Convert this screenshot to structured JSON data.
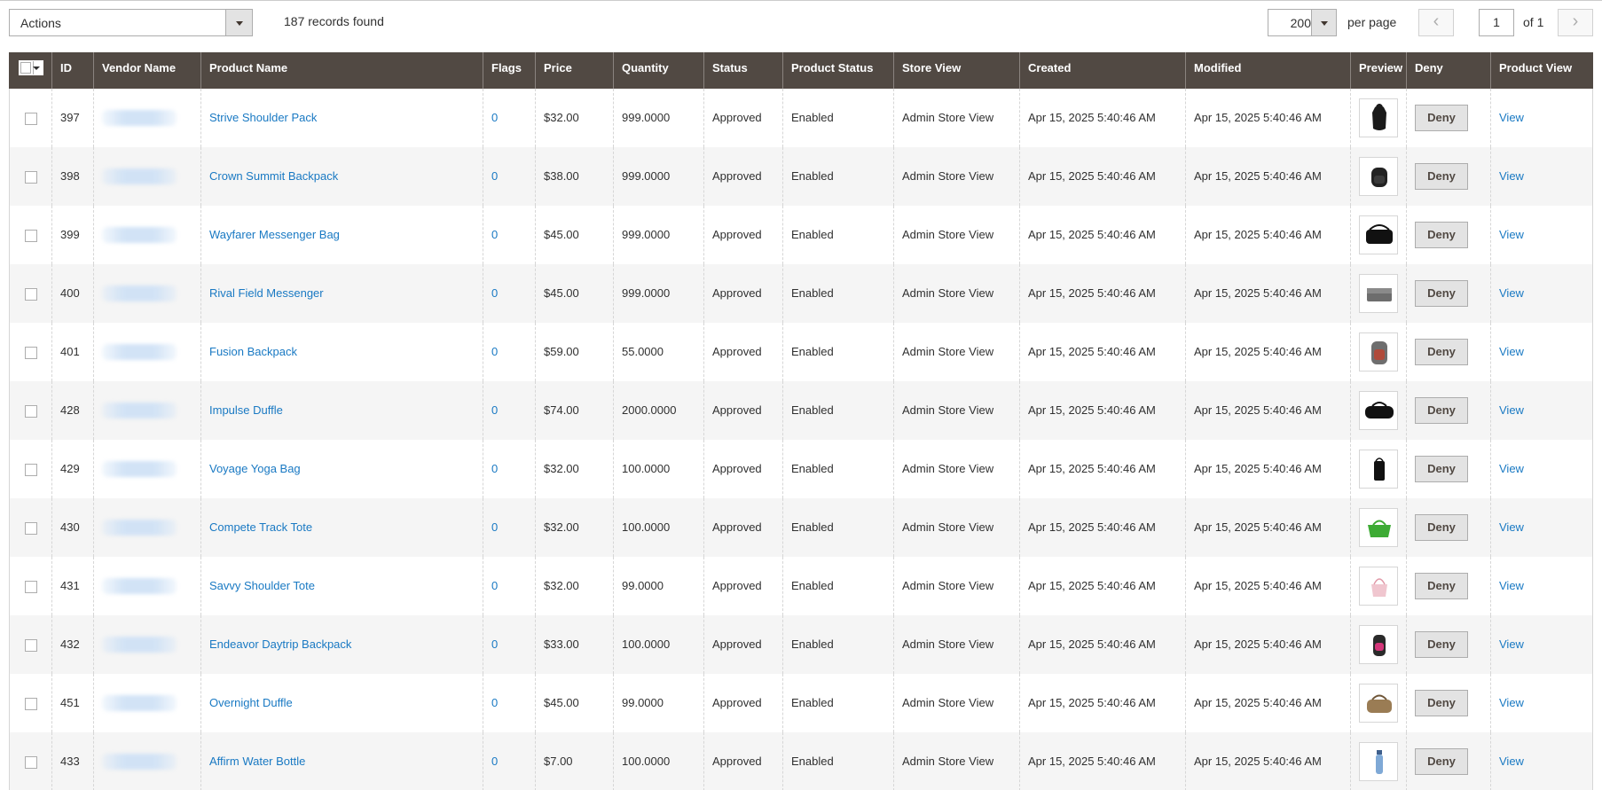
{
  "toolbar": {
    "actions_label": "Actions",
    "records_text": "187 records found",
    "per_page_value": "200",
    "per_page_label": "per page",
    "page_value": "1",
    "page_total": "of 1",
    "prev_glyph": "‹",
    "next_glyph": "›"
  },
  "grid": {
    "columns": [
      "",
      "ID",
      "Vendor Name",
      "Product Name",
      "Flags",
      "Price",
      "Quantity",
      "Status",
      "Product Status",
      "Store View",
      "Created",
      "Modified",
      "Preview",
      "Deny",
      "Product View"
    ],
    "rows": [
      {
        "id": "397",
        "product": "Strive Shoulder Pack",
        "flags": "0",
        "price": "$32.00",
        "qty": "999.0000",
        "status": "Approved",
        "pstatus": "Enabled",
        "store": "Admin Store View",
        "created": "Apr 15, 2025 5:40:46 AM",
        "modified": "Apr 15, 2025 5:40:46 AM",
        "preview": "shoulder-pack-icon",
        "deny": "Deny",
        "view": "View"
      },
      {
        "id": "398",
        "product": "Crown Summit Backpack",
        "flags": "0",
        "price": "$38.00",
        "qty": "999.0000",
        "status": "Approved",
        "pstatus": "Enabled",
        "store": "Admin Store View",
        "created": "Apr 15, 2025 5:40:46 AM",
        "modified": "Apr 15, 2025 5:40:46 AM",
        "preview": "backpack-icon",
        "deny": "Deny",
        "view": "View"
      },
      {
        "id": "399",
        "product": "Wayfarer Messenger Bag",
        "flags": "0",
        "price": "$45.00",
        "qty": "999.0000",
        "status": "Approved",
        "pstatus": "Enabled",
        "store": "Admin Store View",
        "created": "Apr 15, 2025 5:40:46 AM",
        "modified": "Apr 15, 2025 5:40:46 AM",
        "preview": "messenger-bag-icon",
        "deny": "Deny",
        "view": "View"
      },
      {
        "id": "400",
        "product": "Rival Field Messenger",
        "flags": "0",
        "price": "$45.00",
        "qty": "999.0000",
        "status": "Approved",
        "pstatus": "Enabled",
        "store": "Admin Store View",
        "created": "Apr 15, 2025 5:40:46 AM",
        "modified": "Apr 15, 2025 5:40:46 AM",
        "preview": "field-messenger-icon",
        "deny": "Deny",
        "view": "View"
      },
      {
        "id": "401",
        "product": "Fusion Backpack",
        "flags": "0",
        "price": "$59.00",
        "qty": "55.0000",
        "status": "Approved",
        "pstatus": "Enabled",
        "store": "Admin Store View",
        "created": "Apr 15, 2025 5:40:46 AM",
        "modified": "Apr 15, 2025 5:40:46 AM",
        "preview": "fusion-backpack-icon",
        "deny": "Deny",
        "view": "View"
      },
      {
        "id": "428",
        "product": "Impulse Duffle",
        "flags": "0",
        "price": "$74.00",
        "qty": "2000.0000",
        "status": "Approved",
        "pstatus": "Enabled",
        "store": "Admin Store View",
        "created": "Apr 15, 2025 5:40:46 AM",
        "modified": "Apr 15, 2025 5:40:46 AM",
        "preview": "duffle-icon",
        "deny": "Deny",
        "view": "View"
      },
      {
        "id": "429",
        "product": "Voyage Yoga Bag",
        "flags": "0",
        "price": "$32.00",
        "qty": "100.0000",
        "status": "Approved",
        "pstatus": "Enabled",
        "store": "Admin Store View",
        "created": "Apr 15, 2025 5:40:46 AM",
        "modified": "Apr 15, 2025 5:40:46 AM",
        "preview": "yoga-bag-icon",
        "deny": "Deny",
        "view": "View"
      },
      {
        "id": "430",
        "product": "Compete Track Tote",
        "flags": "0",
        "price": "$32.00",
        "qty": "100.0000",
        "status": "Approved",
        "pstatus": "Enabled",
        "store": "Admin Store View",
        "created": "Apr 15, 2025 5:40:46 AM",
        "modified": "Apr 15, 2025 5:40:46 AM",
        "preview": "green-tote-icon",
        "deny": "Deny",
        "view": "View"
      },
      {
        "id": "431",
        "product": "Savvy Shoulder Tote",
        "flags": "0",
        "price": "$32.00",
        "qty": "99.0000",
        "status": "Approved",
        "pstatus": "Enabled",
        "store": "Admin Store View",
        "created": "Apr 15, 2025 5:40:46 AM",
        "modified": "Apr 15, 2025 5:40:46 AM",
        "preview": "pink-tote-icon",
        "deny": "Deny",
        "view": "View"
      },
      {
        "id": "432",
        "product": "Endeavor Daytrip Backpack",
        "flags": "0",
        "price": "$33.00",
        "qty": "100.0000",
        "status": "Approved",
        "pstatus": "Enabled",
        "store": "Admin Store View",
        "created": "Apr 15, 2025 5:40:46 AM",
        "modified": "Apr 15, 2025 5:40:46 AM",
        "preview": "daytrip-backpack-icon",
        "deny": "Deny",
        "view": "View"
      },
      {
        "id": "451",
        "product": "Overnight Duffle",
        "flags": "0",
        "price": "$45.00",
        "qty": "99.0000",
        "status": "Approved",
        "pstatus": "Enabled",
        "store": "Admin Store View",
        "created": "Apr 15, 2025 5:40:46 AM",
        "modified": "Apr 15, 2025 5:40:46 AM",
        "preview": "tan-duffle-icon",
        "deny": "Deny",
        "view": "View"
      },
      {
        "id": "433",
        "product": "Affirm Water Bottle",
        "flags": "0",
        "price": "$7.00",
        "qty": "100.0000",
        "status": "Approved",
        "pstatus": "Enabled",
        "store": "Admin Store View",
        "created": "Apr 15, 2025 5:40:46 AM",
        "modified": "Apr 15, 2025 5:40:46 AM",
        "preview": "water-bottle-icon",
        "deny": "Deny",
        "view": "View"
      }
    ]
  },
  "colors": {
    "header_bg": "#514943",
    "link": "#1979c3",
    "row_alt": "#f5f5f5"
  }
}
